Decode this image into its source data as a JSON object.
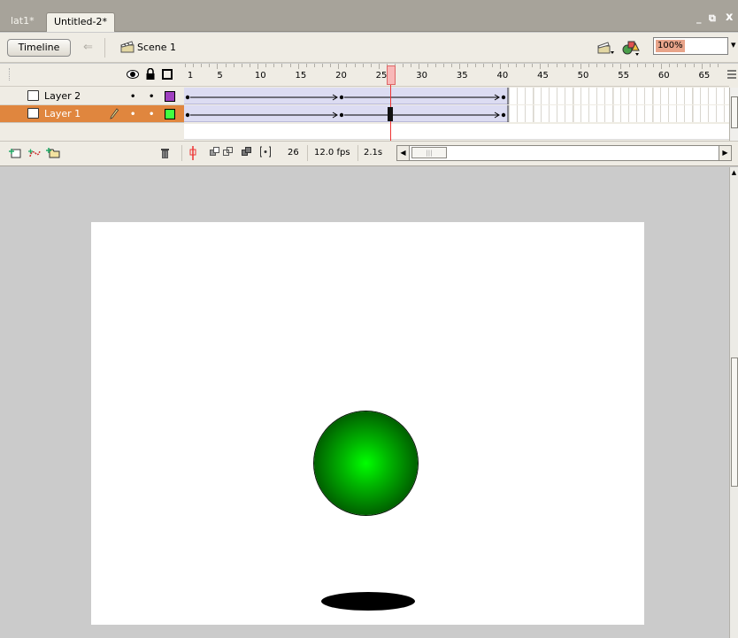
{
  "tabs": [
    {
      "label": "lat1*",
      "active": false
    },
    {
      "label": "Untitled-2*",
      "active": true
    }
  ],
  "window_controls": {
    "minimize": "_",
    "restore": "⧉",
    "close": "x"
  },
  "editbar": {
    "timeline_label": "Timeline",
    "back_glyph": "⇐",
    "scene_label": "Scene 1",
    "zoom_value": "100%",
    "zoom_arrow": "▾"
  },
  "timeline": {
    "frame_numbers": [
      "1",
      "5",
      "10",
      "15",
      "20",
      "25",
      "30",
      "35",
      "40",
      "45",
      "50",
      "55",
      "60",
      "65"
    ],
    "current_frame": 26,
    "layers": [
      {
        "name": "Layer 2",
        "selected": false,
        "color": "#a040c0",
        "visible_dot": "•",
        "lock_dot": "•"
      },
      {
        "name": "Layer 1",
        "selected": true,
        "color": "#40ff40",
        "visible_dot": "•",
        "lock_dot": "•"
      }
    ],
    "frame_counter": "26",
    "fps": "12.0 fps",
    "elapsed": "2.1s",
    "scroll_left_glyph": "◀",
    "scroll_thumb_glyph": "|||",
    "scroll_right_glyph": "▶"
  },
  "stage": {
    "background": "#ffffff",
    "ball_color": "#00ff00",
    "shadow_color": "#000000"
  },
  "icons": [
    "eye-icon",
    "lock-icon",
    "outline-icon",
    "scene-icon",
    "edit-scene-icon",
    "edit-symbol-icon",
    "layer-icon",
    "pencil-icon",
    "add-layer-icon",
    "add-motion-guide-icon",
    "add-folder-icon",
    "trash-icon",
    "center-frame-icon",
    "onion-skin-icon",
    "onion-skin-outline-icon",
    "edit-multiple-frames-icon",
    "modify-onion-markers-icon"
  ]
}
